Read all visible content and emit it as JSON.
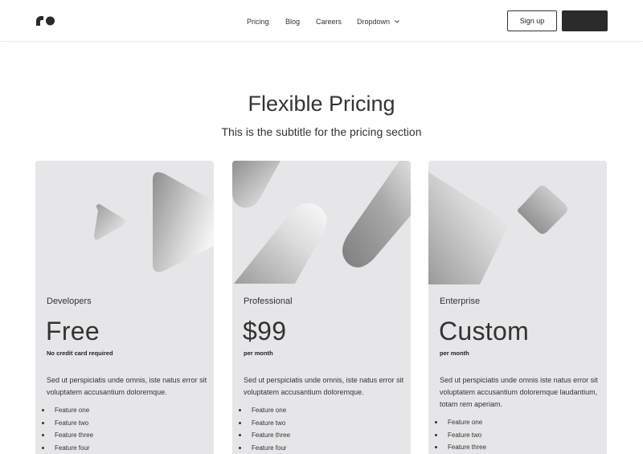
{
  "header": {
    "logo_icon": "ro-logo-mark",
    "nav": [
      {
        "label": "Pricing"
      },
      {
        "label": "Blog"
      },
      {
        "label": "Careers"
      },
      {
        "label": "Dropdown",
        "icon": "chevron-down-icon"
      }
    ],
    "signup_label": "Sign up",
    "dark_button_label": ""
  },
  "hero": {
    "title": "Flexible Pricing",
    "subtitle": "This is the subtitle for the pricing section"
  },
  "plans": [
    {
      "name": "Developers",
      "price": "Free",
      "note": "No credit card required",
      "description": "Sed ut perspiciatis unde omnis, iste natus error sit voluptatem accusantium doloremque.",
      "features": [
        "Feature one",
        "Feature two",
        "Feature three",
        "Feature four"
      ]
    },
    {
      "name": "Professional",
      "price": "$99",
      "note": "per month",
      "description": "Sed ut perspiciatis unde omnis, iste natus error sit voluptatem accusantium doloremque.",
      "features": [
        "Feature one",
        "Feature two",
        "Feature three",
        "Feature four"
      ]
    },
    {
      "name": "Enterprise",
      "price": "Custom",
      "note": "per month",
      "description": "Sed ut perspiciatis unde omnis iste natus error sit voluptatem accusantium doloremque laudantium, totam rem aperiam.",
      "features": [
        "Feature one",
        "Feature two",
        "Feature three"
      ]
    }
  ],
  "colors": {
    "card_bg": "#e6e6e8",
    "dark_button": "#2b2b2b",
    "text": "#333333"
  }
}
